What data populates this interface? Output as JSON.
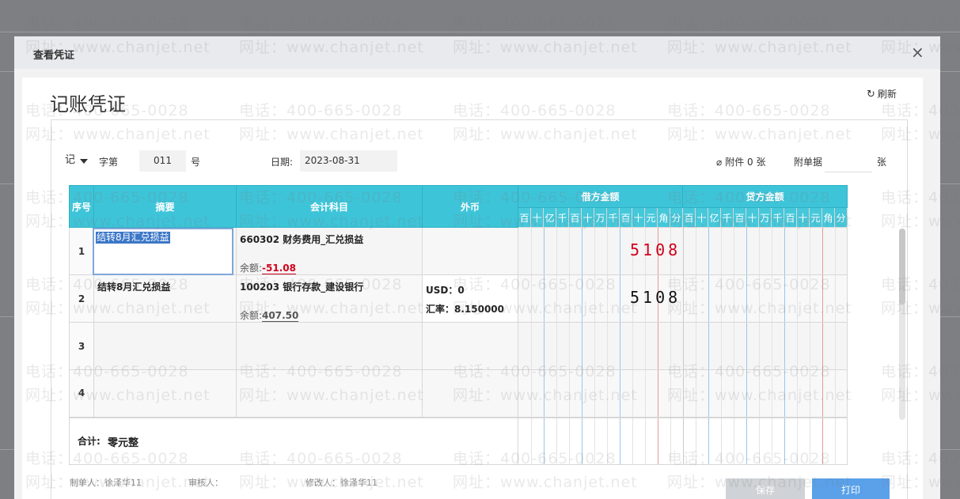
{
  "dialog": {
    "title": "查看凭证",
    "close_symbol": "×"
  },
  "voucher": {
    "heading": "记账凭证",
    "refresh_label": "刷新",
    "type_value": "记",
    "number_label": "字第",
    "number_value": "011",
    "number_suffix": "号",
    "date_label": "日期:",
    "date_value": "2023-08-31",
    "attachment_label": "附件 0 张",
    "attach_docs_label": "附单据",
    "attach_docs_unit": "张"
  },
  "table": {
    "headers": {
      "seq": "序号",
      "summary": "摘要",
      "account": "会计科目",
      "currency": "外币",
      "debit": "借方金额",
      "credit": "贷方金额"
    },
    "digit_units": [
      "百",
      "十",
      "亿",
      "千",
      "百",
      "十",
      "万",
      "千",
      "百",
      "十",
      "元",
      "角",
      "分"
    ],
    "rows": [
      {
        "seq": "1",
        "summary": "结转8月汇兑损益",
        "account": "660302 财务费用_汇兑损益",
        "balance_label": "余额:",
        "balance": "-51.08",
        "currency_line1": "",
        "currency_line2": "",
        "debit_amount": "5108",
        "debit_color": "#d0021b"
      },
      {
        "seq": "2",
        "summary": "结转8月汇兑损益",
        "account": "100203 银行存款_建设银行",
        "balance_label": "余额:",
        "balance": "407.50",
        "currency_line1": "USD：0",
        "currency_line2": "汇率：8.150000",
        "debit_amount": "5108",
        "debit_color": "#111111"
      },
      {
        "seq": "3"
      },
      {
        "seq": "4"
      }
    ],
    "total": {
      "label": "合计:",
      "value": "零元整"
    }
  },
  "footer": {
    "maker_label": "制单人：",
    "maker": "徐泽华11",
    "reviewer_label": "审核人：",
    "reviewer": "",
    "modifier_label": "修改人：",
    "modifier": "徐泽华11",
    "save_label": "保存",
    "print_label": "打印"
  },
  "watermark": {
    "phone": "电话：400-665-0028",
    "site": "网址：www.chanjet.net"
  }
}
